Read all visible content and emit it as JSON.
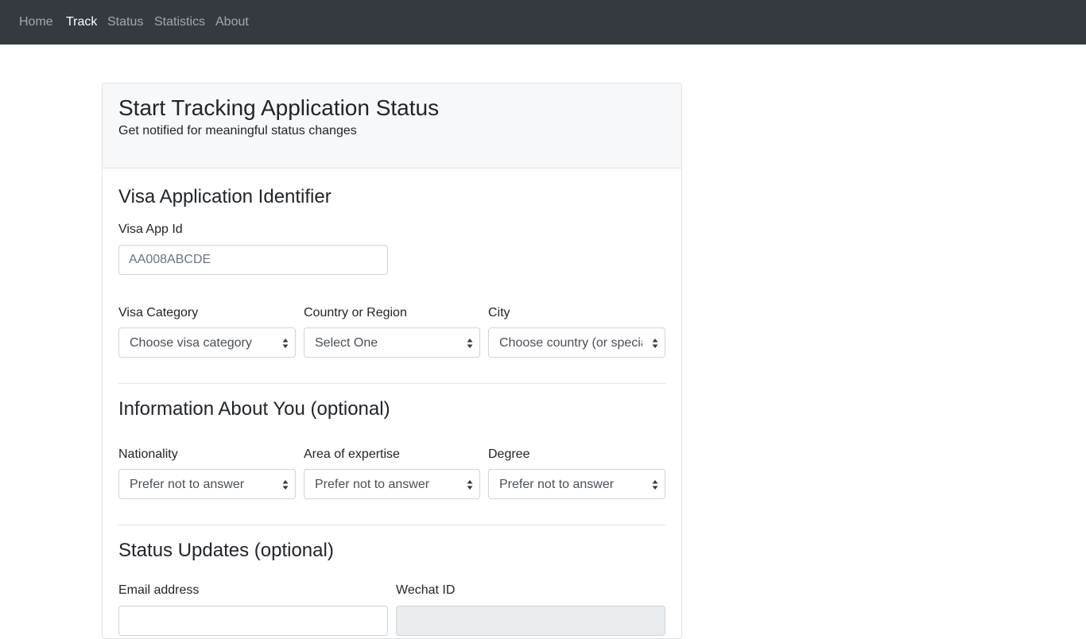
{
  "nav": {
    "items": [
      {
        "label": "Home",
        "active": false
      },
      {
        "label": "Track",
        "active": true
      },
      {
        "label": "Status",
        "active": false
      },
      {
        "label": "Statistics",
        "active": false
      },
      {
        "label": "About",
        "active": false
      }
    ]
  },
  "header": {
    "title": "Start Tracking Application Status",
    "subtitle": "Get notified for meaningful status changes"
  },
  "identifier": {
    "heading": "Visa Application Identifier",
    "app_id_label": "Visa App Id",
    "app_id_placeholder": "AA008ABCDE",
    "category_label": "Visa Category",
    "category_value": "Choose visa category",
    "country_label": "Country or Region",
    "country_value": "Select One",
    "city_label": "City",
    "city_value": "Choose country (or special region) first"
  },
  "about_you": {
    "heading": "Information About You (optional)",
    "nationality_label": "Nationality",
    "nationality_value": "Prefer not to answer",
    "expertise_label": "Area of expertise",
    "expertise_value": "Prefer not to answer",
    "degree_label": "Degree",
    "degree_value": "Prefer not to answer"
  },
  "status_updates": {
    "heading": "Status Updates (optional)",
    "email_label": "Email address",
    "wechat_label": "Wechat ID"
  },
  "colors": {
    "navbar_bg": "#343a40",
    "nav_active": "#ffffff",
    "nav_inactive": "#9a9da0",
    "card_header_bg": "#f7f8f9",
    "border": "#ced4da"
  }
}
